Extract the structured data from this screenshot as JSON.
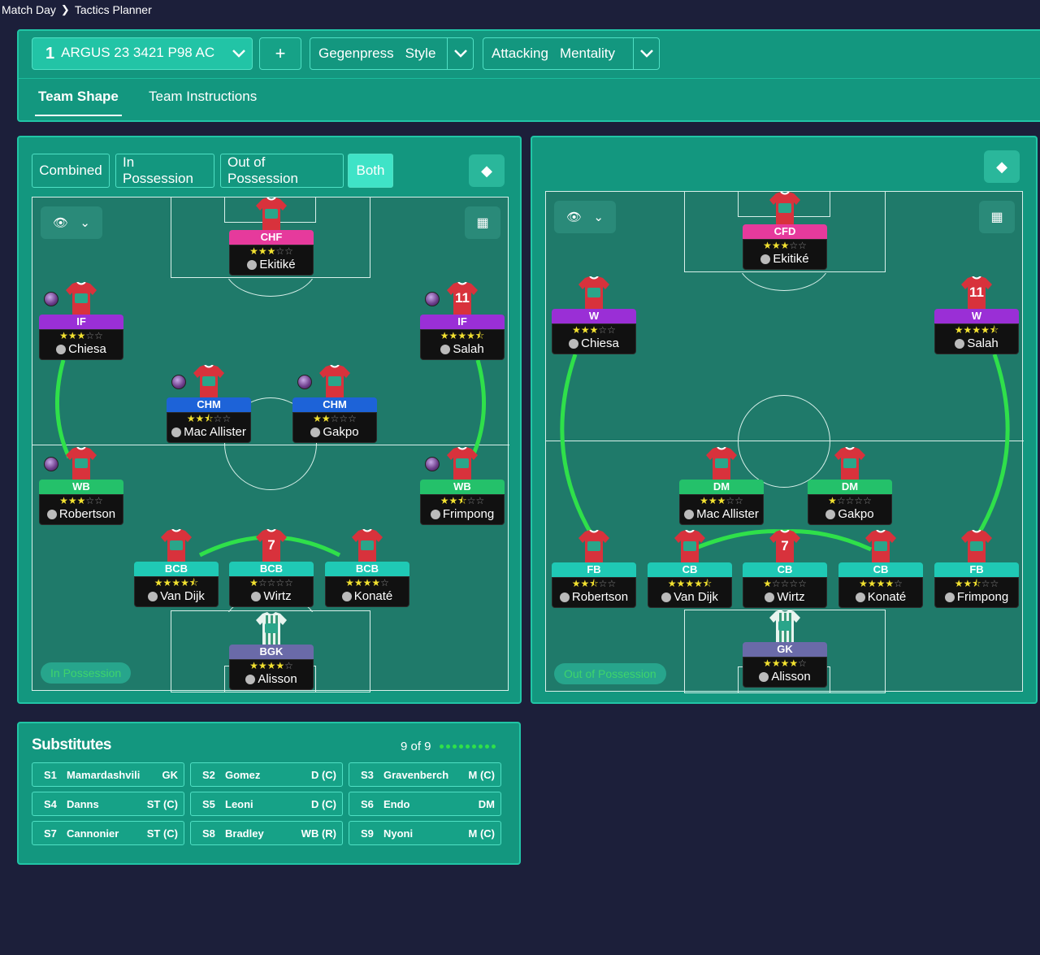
{
  "breadcrumb": {
    "root": "Match Day",
    "current": "Tactics Planner"
  },
  "toolbar": {
    "tactic_number": "1",
    "tactic_name": "ARGUS 23 3421 P98 AC",
    "add_label": "+",
    "style_value": "Gegenpress",
    "style_label": "Style",
    "mentality_value": "Attacking",
    "mentality_label": "Mentality"
  },
  "tabs": [
    "Team Shape",
    "Team Instructions"
  ],
  "modes": [
    "Combined",
    "In Possession",
    "Out of Possession",
    "Both"
  ],
  "active_mode": "Both",
  "in_possession": {
    "legend": "In Possession",
    "players": [
      {
        "role": "CHF",
        "role_color": "#e63a9c",
        "name": "Ekitiké",
        "stars": 3,
        "shirt": "",
        "orb": false
      },
      {
        "role": "IF",
        "role_color": "#9a2fd6",
        "name": "Chiesa",
        "stars": 3,
        "shirt": "",
        "orb": true
      },
      {
        "role": "IF",
        "role_color": "#9a2fd6",
        "name": "Salah",
        "stars": 4.5,
        "shirt": "11",
        "orb": true
      },
      {
        "role": "CHM",
        "role_color": "#1d63d8",
        "name": "Mac Allister",
        "stars": 2.5,
        "shirt": "",
        "orb": true
      },
      {
        "role": "CHM",
        "role_color": "#1d63d8",
        "name": "Gakpo",
        "stars": 2,
        "shirt": "",
        "orb": true
      },
      {
        "role": "WB",
        "role_color": "#24c16a",
        "name": "Robertson",
        "stars": 3,
        "shirt": "",
        "orb": true
      },
      {
        "role": "WB",
        "role_color": "#24c16a",
        "name": "Frimpong",
        "stars": 2.5,
        "shirt": "",
        "orb": true
      },
      {
        "role": "BCB",
        "role_color": "#1fc9b5",
        "name": "Van Dijk",
        "stars": 4.5,
        "shirt": "",
        "orb": false
      },
      {
        "role": "BCB",
        "role_color": "#1fc9b5",
        "name": "Wirtz",
        "stars": 1,
        "shirt": "7",
        "orb": false
      },
      {
        "role": "BCB",
        "role_color": "#1fc9b5",
        "name": "Konaté",
        "stars": 4,
        "shirt": "",
        "orb": false
      },
      {
        "role": "BGK",
        "role_color": "#6a6aa8",
        "name": "Alisson",
        "stars": 4,
        "shirt": "",
        "orb": false,
        "gk": true
      }
    ]
  },
  "out_of_possession": {
    "legend": "Out of Possession",
    "players": [
      {
        "role": "CFD",
        "role_color": "#e63a9c",
        "name": "Ekitiké",
        "stars": 3,
        "shirt": ""
      },
      {
        "role": "W",
        "role_color": "#9a2fd6",
        "name": "Chiesa",
        "stars": 3,
        "shirt": ""
      },
      {
        "role": "W",
        "role_color": "#9a2fd6",
        "name": "Salah",
        "stars": 4.5,
        "shirt": "11"
      },
      {
        "role": "DM",
        "role_color": "#24c16a",
        "name": "Mac Allister",
        "stars": 3,
        "shirt": ""
      },
      {
        "role": "DM",
        "role_color": "#24c16a",
        "name": "Gakpo",
        "stars": 1,
        "shirt": ""
      },
      {
        "role": "FB",
        "role_color": "#1fc9b5",
        "name": "Robertson",
        "stars": 2.5,
        "shirt": ""
      },
      {
        "role": "CB",
        "role_color": "#1fc9b5",
        "name": "Van Dijk",
        "stars": 4.5,
        "shirt": ""
      },
      {
        "role": "CB",
        "role_color": "#1fc9b5",
        "name": "Wirtz",
        "stars": 1,
        "shirt": "7"
      },
      {
        "role": "CB",
        "role_color": "#1fc9b5",
        "name": "Konaté",
        "stars": 4,
        "shirt": ""
      },
      {
        "role": "FB",
        "role_color": "#1fc9b5",
        "name": "Frimpong",
        "stars": 2.5,
        "shirt": ""
      },
      {
        "role": "GK",
        "role_color": "#6a6aa8",
        "name": "Alisson",
        "stars": 4,
        "shirt": "",
        "gk": true
      }
    ]
  },
  "substitutes": {
    "title": "Substitutes",
    "count": "9 of 9",
    "items": [
      {
        "slot": "S1",
        "name": "Mamardashvili",
        "pos": "GK"
      },
      {
        "slot": "S2",
        "name": "Gomez",
        "pos": "D (C)"
      },
      {
        "slot": "S3",
        "name": "Gravenberch",
        "pos": "M (C)"
      },
      {
        "slot": "S4",
        "name": "Danns",
        "pos": "ST (C)"
      },
      {
        "slot": "S5",
        "name": "Leoni",
        "pos": "D (C)"
      },
      {
        "slot": "S6",
        "name": "Endo",
        "pos": "DM"
      },
      {
        "slot": "S7",
        "name": "Cannonier",
        "pos": "ST (C)"
      },
      {
        "slot": "S8",
        "name": "Bradley",
        "pos": "WB (R)"
      },
      {
        "slot": "S9",
        "name": "Nyoni",
        "pos": "M (C)"
      }
    ]
  },
  "colors": {
    "accent": "#3fe3c7",
    "panel": "#13977f",
    "background": "#1c1f3a",
    "link_line": "#2fe04a"
  }
}
